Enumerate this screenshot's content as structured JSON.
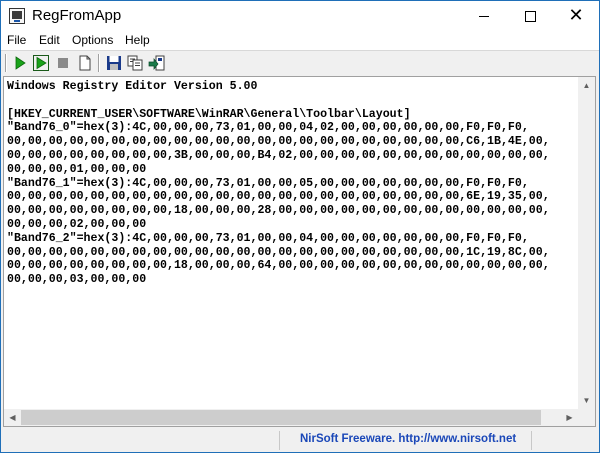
{
  "window": {
    "title": "RegFromApp",
    "icon": "regedit-app-icon"
  },
  "menu": {
    "items": [
      {
        "label": "File"
      },
      {
        "label": "Edit"
      },
      {
        "label": "Options"
      },
      {
        "label": "Help"
      }
    ]
  },
  "toolbar": {
    "buttons": [
      {
        "name": "play-icon",
        "color": "#1aa31a"
      },
      {
        "name": "play-record-icon",
        "color": "#1aa31a"
      },
      {
        "name": "stop-icon",
        "color": "#808080"
      },
      {
        "name": "new-document-icon"
      },
      {
        "name": "save-disk-icon",
        "color": "#1a3a8a"
      },
      {
        "name": "copy-icon"
      },
      {
        "name": "export-arrow-icon",
        "color": "#1a7a4a"
      }
    ]
  },
  "editor": {
    "lines": [
      "Windows Registry Editor Version 5.00",
      "",
      "[HKEY_CURRENT_USER\\SOFTWARE\\WinRAR\\General\\Toolbar\\Layout]",
      "\"Band76_0\"=hex(3):4C,00,00,00,73,01,00,00,04,02,00,00,00,00,00,00,F0,F0,F0,",
      "00,00,00,00,00,00,00,00,00,00,00,00,00,00,00,00,00,00,00,00,00,00,C6,1B,4E,00,",
      "00,00,00,00,00,00,00,00,3B,00,00,00,B4,02,00,00,00,00,00,00,00,00,00,00,00,00,",
      "00,00,00,01,00,00,00",
      "\"Band76_1\"=hex(3):4C,00,00,00,73,01,00,00,05,00,00,00,00,00,00,00,F0,F0,F0,",
      "00,00,00,00,00,00,00,00,00,00,00,00,00,00,00,00,00,00,00,00,00,00,6E,19,35,00,",
      "00,00,00,00,00,00,00,00,18,00,00,00,28,00,00,00,00,00,00,00,00,00,00,00,00,00,",
      "00,00,00,02,00,00,00",
      "\"Band76_2\"=hex(3):4C,00,00,00,73,01,00,00,04,00,00,00,00,00,00,00,F0,F0,F0,",
      "00,00,00,00,00,00,00,00,00,00,00,00,00,00,00,00,00,00,00,00,00,00,1C,19,8C,00,",
      "00,00,00,00,00,00,00,00,18,00,00,00,64,00,00,00,00,00,00,00,00,00,00,00,00,00,",
      "00,00,00,03,00,00,00"
    ]
  },
  "statusbar": {
    "link_text": "NirSoft Freeware.  http://www.nirsoft.net",
    "link_color": "#1a47b8"
  }
}
